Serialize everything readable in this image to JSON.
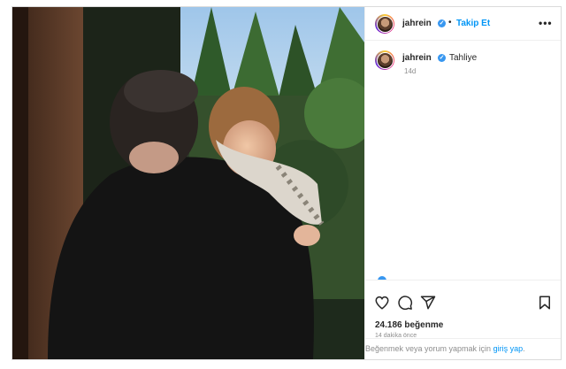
{
  "post": {
    "username": "jahrein",
    "verified_mark": "✓",
    "separator": "•",
    "follow_label": "Takip Et",
    "more_label": "•••",
    "caption": "Tahliye",
    "caption_time": "14d"
  },
  "actions": {
    "icons": [
      "heart-icon",
      "comment-icon",
      "share-icon",
      "bookmark-icon"
    ],
    "likes": "24.186 beğenme",
    "time_ago": "14 dakika önce"
  },
  "login_bar": {
    "prefix": "Beğenmek veya yorum yapmak için ",
    "link": "giriş yap",
    "suffix": "."
  },
  "colors": {
    "accent": "#0095f6",
    "verified": "#3897f0",
    "text": "#262626",
    "muted": "#8e8e8e"
  }
}
